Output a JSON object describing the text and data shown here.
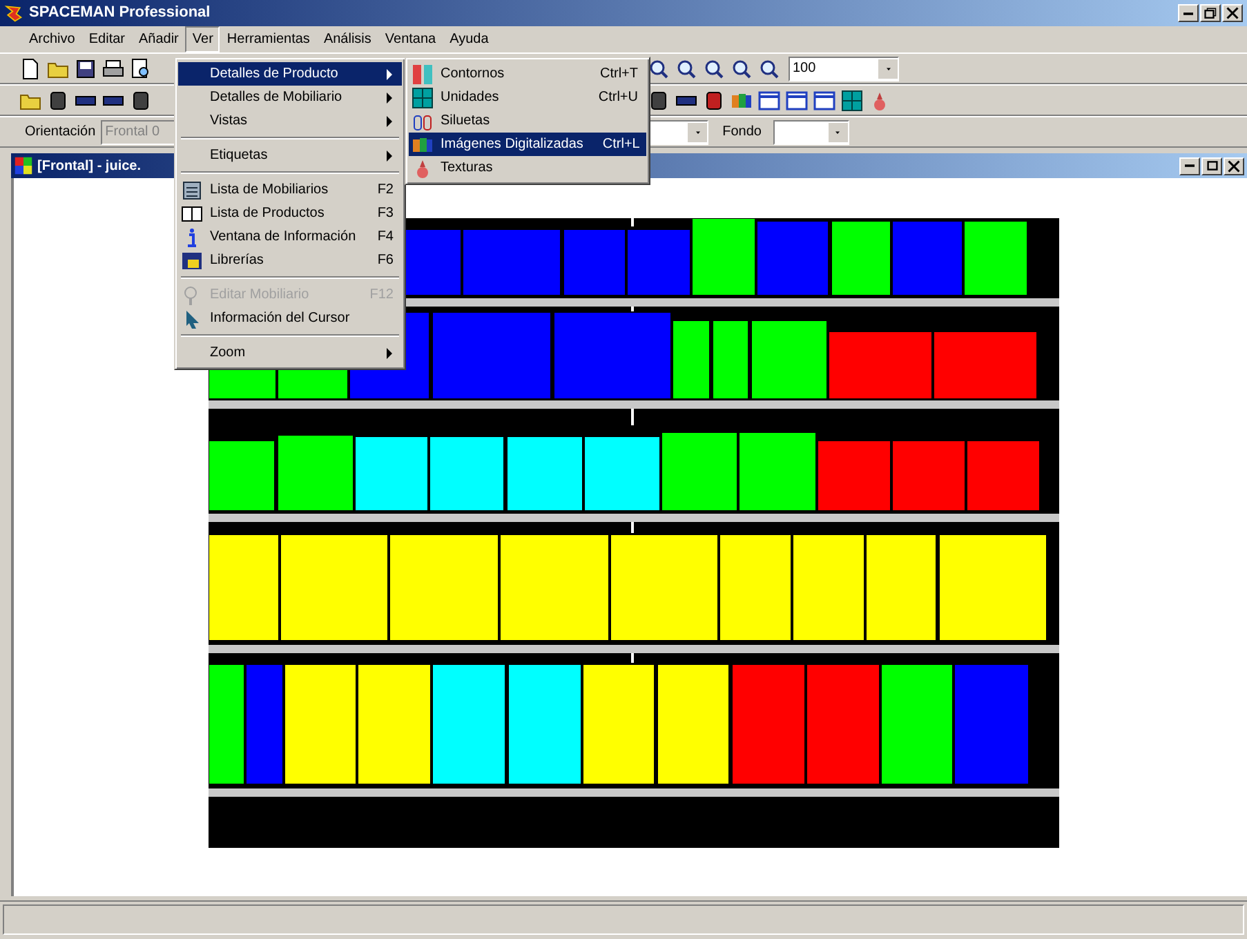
{
  "window": {
    "title": "SPACEMAN Professional"
  },
  "menu_bar": [
    {
      "label": "Archivo",
      "selected": false
    },
    {
      "label": "Editar",
      "selected": false
    },
    {
      "label": "Añadir",
      "selected": false
    },
    {
      "label": "Ver",
      "selected": true
    },
    {
      "label": "Herramientas",
      "selected": false
    },
    {
      "label": "Análisis",
      "selected": false
    },
    {
      "label": "Ventana",
      "selected": false
    },
    {
      "label": "Ayuda",
      "selected": false
    }
  ],
  "toolbar": {
    "zoom_combo": {
      "value": "100"
    },
    "orientation_label": "Orientación",
    "orientation_combo": {
      "value": "Frontal 0",
      "disabled": true
    },
    "background_label": "Fondo"
  },
  "child_window": {
    "title": "[Frontal] - juice."
  },
  "ver_menu": [
    {
      "kind": "item",
      "label": "Detalles de Producto",
      "has_submenu": true,
      "selected": true,
      "disabled": false
    },
    {
      "kind": "item",
      "label": "Detalles de Mobiliario",
      "has_submenu": true,
      "selected": false,
      "disabled": false
    },
    {
      "kind": "item",
      "label": "Vistas",
      "has_submenu": true,
      "selected": false,
      "disabled": false
    },
    {
      "kind": "separator"
    },
    {
      "kind": "item",
      "label": "Etiquetas",
      "has_submenu": true,
      "selected": false,
      "disabled": false
    },
    {
      "kind": "separator"
    },
    {
      "kind": "item",
      "label": "Lista de Mobiliarios",
      "shortcut": "F2",
      "selected": false,
      "disabled": false
    },
    {
      "kind": "item",
      "label": "Lista de Productos",
      "shortcut": "F3",
      "selected": false,
      "disabled": false
    },
    {
      "kind": "item",
      "label": "Ventana de Información",
      "shortcut": "F4",
      "selected": false,
      "disabled": false
    },
    {
      "kind": "item",
      "label": "Librerías",
      "shortcut": "F6",
      "selected": false,
      "disabled": false
    },
    {
      "kind": "separator"
    },
    {
      "kind": "item",
      "label": "Editar Mobiliario",
      "shortcut": "F12",
      "selected": false,
      "disabled": true
    },
    {
      "kind": "item",
      "label": "Información del Cursor",
      "selected": false,
      "disabled": false
    },
    {
      "kind": "separator"
    },
    {
      "kind": "item",
      "label": "Zoom",
      "has_submenu": true,
      "selected": false,
      "disabled": false
    }
  ],
  "product_submenu": [
    {
      "label": "Contornos",
      "shortcut": "Ctrl+T",
      "selected": false
    },
    {
      "label": "Unidades",
      "shortcut": "Ctrl+U",
      "selected": false
    },
    {
      "label": "Siluetas",
      "selected": false
    },
    {
      "label": "Imágenes Digitalizadas",
      "shortcut": "Ctrl+L",
      "selected": true
    },
    {
      "label": "Texturas",
      "selected": false
    }
  ],
  "planogram": {
    "shelves": [
      {
        "products": [
          {
            "color": "#0000ff"
          },
          {
            "color": "#0000ff"
          },
          {
            "color": "#0000ff"
          },
          {
            "color": "#0000ff"
          },
          {
            "color": "#00ff00"
          },
          {
            "color": "#0000ff"
          },
          {
            "color": "#00ff00"
          },
          {
            "color": "#0000ff"
          },
          {
            "color": "#00ff00"
          }
        ]
      },
      {
        "products": [
          {
            "color": "#00ff00"
          },
          {
            "color": "#00ff00"
          },
          {
            "color": "#0000ff"
          },
          {
            "color": "#0000ff"
          },
          {
            "color": "#0000ff"
          },
          {
            "color": "#00ff00"
          },
          {
            "color": "#00ff00"
          },
          {
            "color": "#00ff00"
          },
          {
            "color": "#ff0000"
          },
          {
            "color": "#ff0000"
          }
        ]
      },
      {
        "products": [
          {
            "color": "#00ff00"
          },
          {
            "color": "#00ff00"
          },
          {
            "color": "#00ffff"
          },
          {
            "color": "#00ffff"
          },
          {
            "color": "#00ffff"
          },
          {
            "color": "#00ffff"
          },
          {
            "color": "#00ff00"
          },
          {
            "color": "#00ff00"
          },
          {
            "color": "#ff0000"
          },
          {
            "color": "#ff0000"
          },
          {
            "color": "#ff0000"
          }
        ]
      },
      {
        "products": [
          {
            "color": "#ffff00"
          },
          {
            "color": "#ffff00"
          },
          {
            "color": "#ffff00"
          },
          {
            "color": "#ffff00"
          },
          {
            "color": "#ffff00"
          },
          {
            "color": "#ffff00"
          },
          {
            "color": "#ffff00"
          },
          {
            "color": "#ffff00"
          },
          {
            "color": "#ffff00"
          }
        ]
      },
      {
        "products": [
          {
            "color": "#00ff00"
          },
          {
            "color": "#0000ff"
          },
          {
            "color": "#ffff00"
          },
          {
            "color": "#ffff00"
          },
          {
            "color": "#00ffff"
          },
          {
            "color": "#00ffff"
          },
          {
            "color": "#ffff00"
          },
          {
            "color": "#ffff00"
          },
          {
            "color": "#ff0000"
          },
          {
            "color": "#ff0000"
          },
          {
            "color": "#00ff00"
          },
          {
            "color": "#0000ff"
          }
        ]
      }
    ]
  }
}
